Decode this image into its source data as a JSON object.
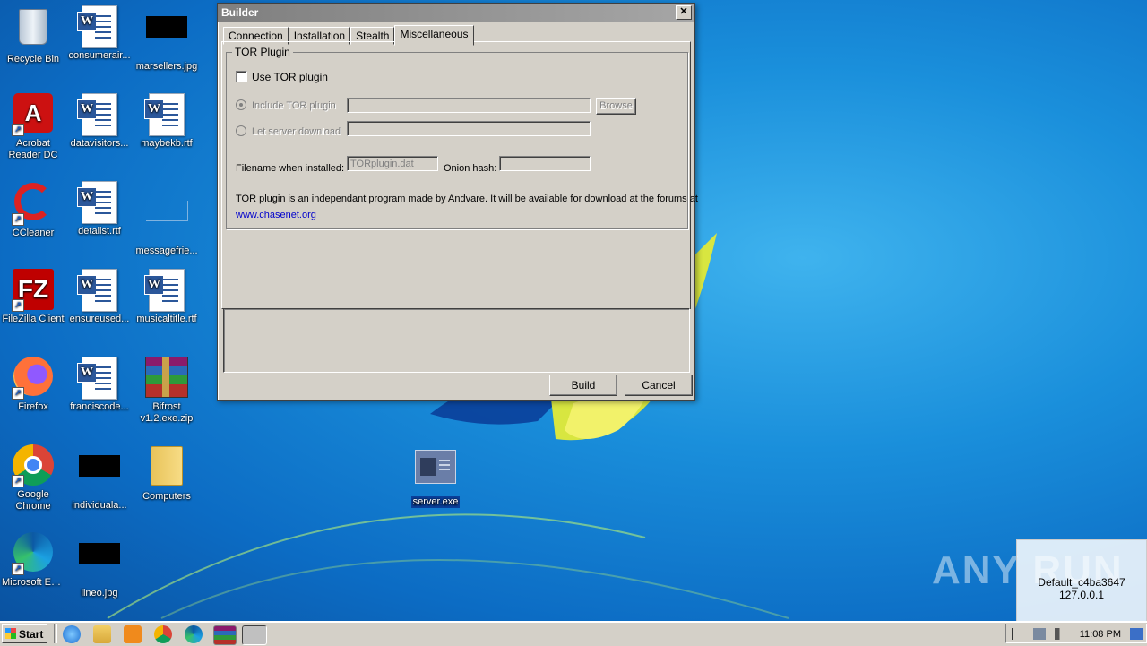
{
  "desktop": {
    "icons": [
      {
        "label": "Recycle Bin"
      },
      {
        "label": "consumerair..."
      },
      {
        "label": "marsellers.jpg"
      },
      {
        "label": "Acrobat Reader DC"
      },
      {
        "label": "datavisitors..."
      },
      {
        "label": "maybekb.rtf"
      },
      {
        "label": "CCleaner"
      },
      {
        "label": "detailst.rtf"
      },
      {
        "label": "messagefrie..."
      },
      {
        "label": "FileZilla Client"
      },
      {
        "label": "ensureused..."
      },
      {
        "label": "musicaltitle.rtf"
      },
      {
        "label": "Firefox"
      },
      {
        "label": "franciscode..."
      },
      {
        "label": "Bifrost v1.2.exe.zip"
      },
      {
        "label": "Google Chrome"
      },
      {
        "label": "individuala..."
      },
      {
        "label": "Computers"
      },
      {
        "label": "Microsoft Edge"
      },
      {
        "label": "lineo.jpg"
      },
      {
        "label": "server.exe"
      }
    ]
  },
  "dialog": {
    "title": "Builder",
    "close_label": "✕",
    "tabs": [
      {
        "label": "Connection"
      },
      {
        "label": "Installation"
      },
      {
        "label": "Stealth"
      },
      {
        "label": "Miscellaneous"
      }
    ],
    "group_title": "TOR Plugin",
    "use_tor_label": "Use TOR plugin",
    "include_tor_label": "Include TOR plugin",
    "include_tor_value": "",
    "browse_label": "Browse",
    "let_server_label": "Let server download",
    "let_server_value": "",
    "filename_label": "Filename when installed:",
    "filename_value": "TORplugin.dat",
    "onion_label": "Onion hash:",
    "onion_value": "",
    "info_text": "TOR plugin is an independant program made by Andvare. It will be available for download at the forums at",
    "info_link": "www.chasenet.org",
    "build_label": "Build",
    "cancel_label": "Cancel"
  },
  "taskbar": {
    "start_label": "Start",
    "clock": "11:08 PM"
  },
  "watermark": {
    "text": "ANY RUN",
    "host": "Default_c4ba3647",
    "ip": "127.0.0.1"
  },
  "colors": {
    "accent_link": "#0000cc",
    "dialog_face": "#d4d0c8"
  }
}
